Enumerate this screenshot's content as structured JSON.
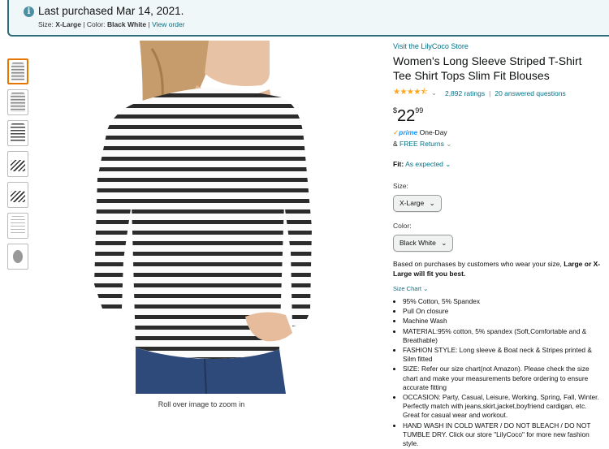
{
  "banner": {
    "title": "Last purchased Mar 14, 2021.",
    "size_label": "Size:",
    "size_value": "X-Large",
    "color_label": "Color:",
    "color_value": "Black White",
    "view_order": "View order"
  },
  "thumbnails": [
    "thumb-1",
    "thumb-2",
    "thumb-3",
    "thumb-4",
    "thumb-5",
    "thumb-6",
    "thumb-7"
  ],
  "image_caption": "Roll over image to zoom in",
  "product": {
    "store_link": "Visit the LilyCoco Store",
    "title": "Women's Long Sleeve Striped T-Shirt Tee Shirt Tops Slim Fit Blouses",
    "stars": "★★★★⯪",
    "rating_count": "2,892 ratings",
    "answered": "20 answered questions",
    "price_symbol": "$",
    "price_whole": "22",
    "price_fraction": "99",
    "prime_text": "prime",
    "prime_suffix": "One-Day",
    "returns_prefix": "& ",
    "returns": "FREE Returns",
    "fit_label": "Fit:",
    "fit_value": "As expected",
    "size_label": "Size:",
    "size_selected": "X-Large",
    "color_label": "Color:",
    "color_selected": "Black White",
    "rec_prefix": "Based on purchases by customers who wear your size,",
    "rec_bold": "Large or X-Large will fit you best.",
    "size_chart": "Size Chart",
    "bullets": [
      "95% Cotton, 5% Spandex",
      "Pull On closure",
      "Machine Wash",
      "MATERIAL:95% cotton, 5% spandex (Soft,Comfortable and & Breathable)",
      "FASHION STYLE: Long sleeve & Boat neck & Stripes printed & Silm fitted",
      "SIZE: Refer our size chart(not Amazon). Please check the size chart and make your measurements before ordering to ensure accurate fitting",
      "OCCASION: Party, Casual, Leisure, Working, Spring, Fall, Winter. Perfectly match with jeans,skirt,jacket,boyfriend cardigan, etc. Great for casual wear and workout.",
      "HAND WASH IN COLD WATER / DO NOT BLEACH / DO NOT TUMBLE DRY. Click our store \"LilyCoco\" for more new fashion style."
    ]
  },
  "colors": {
    "link": "#007185",
    "star": "#ffa41c",
    "prime": "#1a98ff",
    "banner_border": "#2f6b78"
  }
}
